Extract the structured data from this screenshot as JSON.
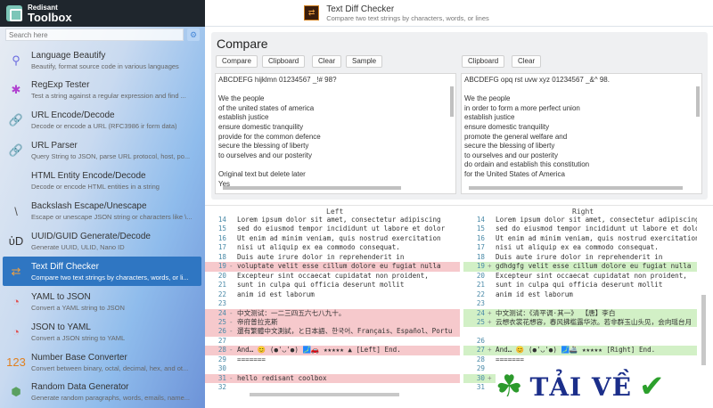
{
  "app": {
    "brand_small": "Redisant",
    "brand": "Toolbox",
    "search_placeholder": "Search here"
  },
  "sidebar": {
    "items": [
      {
        "name": "Language Beautify",
        "desc": "Beautify, format source code in various languages",
        "icon": "brush-icon",
        "glyph": "⚲",
        "color": "#6a6adf"
      },
      {
        "name": "RegExp Tester",
        "desc": "Test a string against a regular expression and find ...",
        "icon": "asterisk-icon",
        "glyph": "✱",
        "color": "#b040d0"
      },
      {
        "name": "URL Encode/Decode",
        "desc": "Decode or encode a URL (RFC3986 ir form data)",
        "icon": "link-icon",
        "glyph": "🔗",
        "color": "#2a7fd0"
      },
      {
        "name": "URL Parser",
        "desc": "Query String to JSON, parse URL protocol, host, po...",
        "icon": "link-icon",
        "glyph": "🔗",
        "color": "#2a7fd0"
      },
      {
        "name": "HTML Entity Encode/Decode",
        "desc": "Decode or encode HTML entities in a string",
        "icon": "code-icon",
        "glyph": "</>",
        "color": "#3a5ad0"
      },
      {
        "name": "Backslash Escape/Unescape",
        "desc": "Escape or unescape JSON string or characters like \\...",
        "icon": "backslash-icon",
        "glyph": "\\",
        "color": "#555"
      },
      {
        "name": "UUID/GUID Generate/Decode",
        "desc": "Generate UUID, ULID, Nano ID",
        "icon": "uuid-icon",
        "glyph": "ὑD",
        "color": "#333"
      },
      {
        "name": "Text Diff Checker",
        "desc": "Compare two text strings by characters, words, or li...",
        "icon": "diff-icon",
        "glyph": "⇄",
        "color": "#f0a040",
        "selected": true
      },
      {
        "name": "YAML to JSON",
        "desc": "Convert a YAML string to JSON",
        "icon": "convert-icon",
        "glyph": "◔",
        "color": "#e05050"
      },
      {
        "name": "JSON to YAML",
        "desc": "Convert a JSON string to YAML",
        "icon": "convert-icon",
        "glyph": "◔",
        "color": "#e05050"
      },
      {
        "name": "Number Base Converter",
        "desc": "Convert between binary, octal, decimal, hex, and ot...",
        "icon": "numbers-icon",
        "glyph": "123",
        "color": "#e08020"
      },
      {
        "name": "Random Data Generator",
        "desc": "Generate random paragraphs, words, emails, name...",
        "icon": "dice-icon",
        "glyph": "⬢",
        "color": "#5aa060"
      }
    ]
  },
  "header": {
    "title": "Text Diff Checker",
    "subtitle": "Compare two text strings by characters, words, or lines"
  },
  "compare": {
    "title": "Compare",
    "left_buttons": [
      "Compare",
      "Clipboard",
      "Clear",
      "Sample"
    ],
    "right_buttons": [
      "Clipboard",
      "Clear"
    ],
    "left_text": "ABCDEFG hijklmn 01234567 _!# 98?\n\nWe the people\nof the united states of america\nestablish justice\nensure domestic tranquility\nprovide for the common defence\nsecure the blessing of liberty\nto ourselves and our posterity\n\nOriginal text but delete later\nYes",
    "right_text": "ABCDEFG opq rst uvw xyz 01234567 _&^ 98.\n\nWe the people\nin order to form a more perfect union\nestablish justice\nensure domestic tranquility\npromote the general welfare and\nsecure the blessing of liberty\nto ourselves and our posterity\ndo ordain and establish this constitution\nfor the United States of America"
  },
  "diff": {
    "left_label": "Left",
    "right_label": "Right",
    "left": [
      {
        "n": "14",
        "s": "",
        "t": "Lorem ipsum dolor sit amet, consectetur adipiscing",
        "k": ""
      },
      {
        "n": "15",
        "s": "",
        "t": "sed do eiusmod tempor incididunt ut labore et dolor",
        "k": ""
      },
      {
        "n": "16",
        "s": "",
        "t": "Ut enim ad minim veniam, quis nostrud exercitation",
        "k": ""
      },
      {
        "n": "17",
        "s": "",
        "t": "nisi ut aliquip ex ea commodo consequat.",
        "k": ""
      },
      {
        "n": "18",
        "s": "",
        "t": "Duis aute irure dolor in reprehenderit in",
        "k": ""
      },
      {
        "n": "19",
        "s": "-",
        "t": "voluptate velit esse cillum dolore eu fugiat nulla",
        "k": "del"
      },
      {
        "n": "20",
        "s": "",
        "t": "Excepteur sint occaecat cupidatat non proident,",
        "k": ""
      },
      {
        "n": "21",
        "s": "",
        "t": "sunt in culpa qui officia deserunt mollit",
        "k": ""
      },
      {
        "n": "22",
        "s": "",
        "t": "anim id est laborum",
        "k": ""
      },
      {
        "n": "23",
        "s": "",
        "t": "",
        "k": ""
      },
      {
        "n": "24",
        "s": "-",
        "t": "中文测试：一二三四五六七八九十。",
        "k": "del"
      },
      {
        "n": "25",
        "s": "-",
        "t": "帝府普拉克斯",
        "k": "del"
      },
      {
        "n": "26",
        "s": "-",
        "t": "還有繁體中文測試，と日本語、한국어、Français、Español、Portu",
        "k": "del"
      },
      {
        "n": "27",
        "s": "",
        "t": "",
        "k": ""
      },
      {
        "n": "28",
        "s": "-",
        "t": "And… 😊 (●'◡'●) 🗾🚗 ★★★★★ ▲ [Left] End.",
        "k": "del"
      },
      {
        "n": "29",
        "s": "",
        "t": "=======",
        "k": ""
      },
      {
        "n": "30",
        "s": "",
        "t": "",
        "k": ""
      },
      {
        "n": "31",
        "s": "-",
        "t": "hello redisant coolbox",
        "k": "del"
      },
      {
        "n": "32",
        "s": "",
        "t": "",
        "k": ""
      }
    ],
    "right": [
      {
        "n": "14",
        "s": "",
        "t": "Lorem ipsum dolor sit amet, consectetur adipiscing",
        "k": ""
      },
      {
        "n": "15",
        "s": "",
        "t": "sed do eiusmod tempor incididunt ut labore et dolor",
        "k": ""
      },
      {
        "n": "16",
        "s": "",
        "t": "Ut enim ad minim veniam, quis nostrud exercitation",
        "k": ""
      },
      {
        "n": "17",
        "s": "",
        "t": "nisi ut aliquip ex ea commodo consequat.",
        "k": ""
      },
      {
        "n": "18",
        "s": "",
        "t": "Duis aute irure dolor in reprehenderit in",
        "k": ""
      },
      {
        "n": "19",
        "s": "+",
        "t": "gdhdgfg velit esse cillum dolore eu fugiat nulla",
        "k": "add"
      },
      {
        "n": "20",
        "s": "",
        "t": "Excepteur sint occaecat cupidatat non proident,",
        "k": ""
      },
      {
        "n": "21",
        "s": "",
        "t": "sunt in culpa qui officia deserunt mollit",
        "k": ""
      },
      {
        "n": "22",
        "s": "",
        "t": "anim id est laborum",
        "k": ""
      },
      {
        "n": "23",
        "s": "",
        "t": "",
        "k": ""
      },
      {
        "n": "24",
        "s": "+",
        "t": "中文测试：《清平调·其一》 【唐】李白",
        "k": "add"
      },
      {
        "n": "25",
        "s": "+",
        "t": "云想衣裳花想容，春风拂槛露华浓。若非群玉山头见，会向瑶台月",
        "k": "add"
      },
      {
        "n": "",
        "s": "",
        "t": "",
        "k": ""
      },
      {
        "n": "26",
        "s": "",
        "t": "",
        "k": ""
      },
      {
        "n": "27",
        "s": "+",
        "t": "And… 😊 (●'◡'●) 🗾🚢 ★★★★★ [Right] End.",
        "k": "add"
      },
      {
        "n": "28",
        "s": "",
        "t": "=======",
        "k": ""
      },
      {
        "n": "29",
        "s": "",
        "t": "",
        "k": ""
      },
      {
        "n": "30",
        "s": "+",
        "t": "",
        "k": "add"
      },
      {
        "n": "31",
        "s": "",
        "t": "",
        "k": ""
      }
    ]
  },
  "watermark": {
    "text": "TẢI VỀ"
  }
}
